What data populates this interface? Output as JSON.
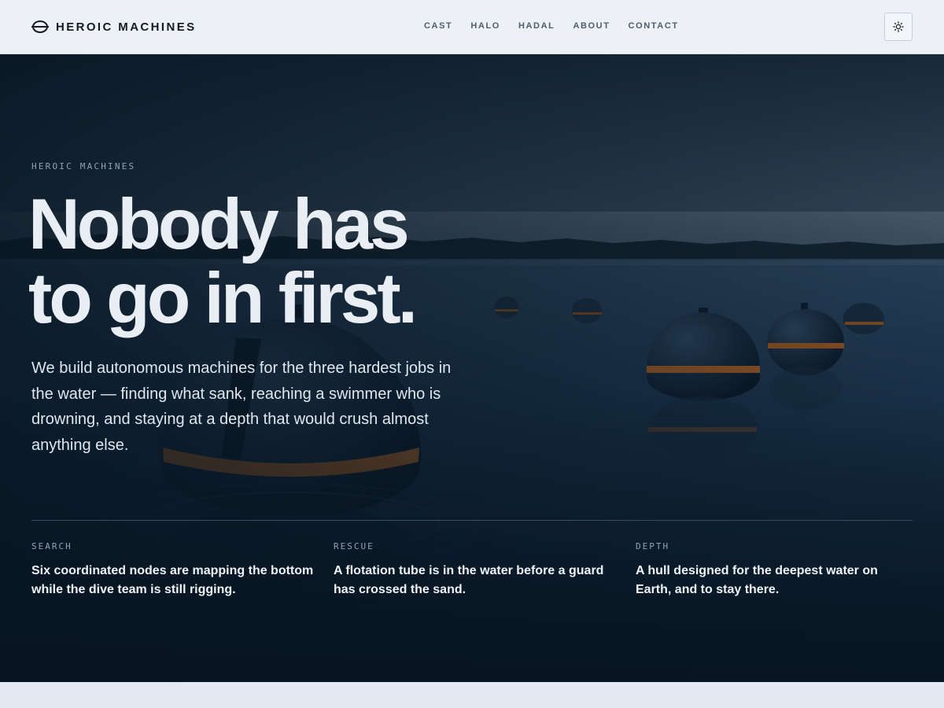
{
  "header": {
    "brand": "HEROIC MACHINES",
    "brand_icon": "hemisphere-logo-icon",
    "nav": [
      "CAST",
      "HALO",
      "HADAL",
      "ABOUT",
      "CONTACT"
    ],
    "theme_toggle_icon": "sun-icon"
  },
  "hero": {
    "eyebrow": "HEROIC MACHINES",
    "headline_line1": "Nobody has",
    "headline_line2": "to go in first.",
    "intro": "We build autonomous machines for the three hardest jobs in the water — finding what sank, reaching a swimmer who is drowning, and staying at a depth that would crush almost anything else.",
    "features": [
      {
        "label": "SEARCH",
        "text": "Six coordinated nodes are mapping the bottom while the dive team is still rigging."
      },
      {
        "label": "RESCUE",
        "text": "A flotation tube is in the water before a guard has crossed the sand."
      },
      {
        "label": "DEPTH",
        "text": "A hull designed for the deepest water on Earth, and to stay there."
      }
    ]
  },
  "colors": {
    "header_bg": "#edf1f5",
    "hero_overlay": "#0d1f30",
    "accent_band": "#e07a22",
    "text_light": "#e8eef4",
    "page_bg": "#e3e9f0"
  }
}
